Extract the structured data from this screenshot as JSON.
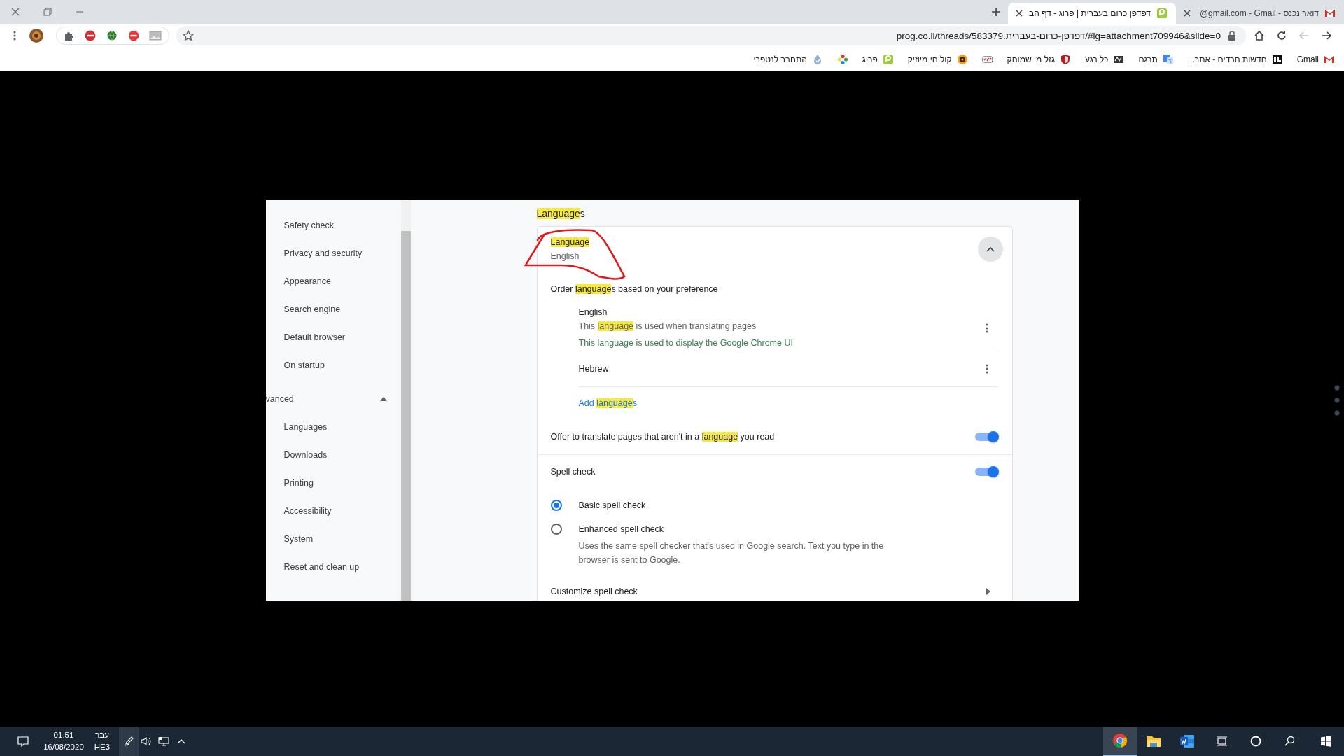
{
  "tabs": [
    {
      "title": "דפדפן כרום בעברית | פרוג - דף הב",
      "kind": "prog",
      "selected": true
    },
    {
      "title": "דואר נכנס - ‎@gmail.com - Gmail",
      "kind": "gmail",
      "selected": false
    }
  ],
  "toolbar": {
    "url": "prog.co.il/threads/583379.דפדפן-כרום-בעברית/#lg=attachment709946&slide=0",
    "nav_buttons": [
      {
        "kind": "back",
        "disabled": false
      },
      {
        "kind": "forward",
        "disabled": true
      }
    ]
  },
  "bookmarks": [
    {
      "kind": "gmail",
      "label": "Gmail"
    },
    {
      "kind": "news",
      "label": "חדשות חרדים - אתר..."
    },
    {
      "kind": "translate",
      "label": "תרגם"
    },
    {
      "kind": "moment",
      "label": "כל רגע"
    },
    {
      "kind": "shield",
      "label": "גזל מי שמוחק"
    },
    {
      "kind": "chi"
    },
    {
      "kind": "music",
      "label": "קול חי מיוזיק"
    },
    {
      "kind": "prog",
      "label": "פרוג"
    },
    {
      "kind": "flower"
    },
    {
      "kind": "netfree",
      "label": "התחבר לנטפרי"
    }
  ],
  "settings": {
    "sidebar": [
      {
        "kind": "item",
        "label": "Safety check"
      },
      {
        "kind": "item",
        "label": "Privacy and security"
      },
      {
        "kind": "item",
        "label": "Appearance"
      },
      {
        "kind": "item",
        "label": "Search engine"
      },
      {
        "kind": "item",
        "label": "Default browser"
      },
      {
        "kind": "item",
        "label": "On startup"
      },
      {
        "kind": "section",
        "label": "vanced",
        "expanded": true
      },
      {
        "kind": "item",
        "label": "Languages"
      },
      {
        "kind": "item",
        "label": "Downloads"
      },
      {
        "kind": "item",
        "label": "Printing"
      },
      {
        "kind": "item",
        "label": "Accessibility"
      },
      {
        "kind": "item",
        "label": "System"
      },
      {
        "kind": "item",
        "label": "Reset and clean up"
      }
    ],
    "heading": [
      {
        "text": "Language",
        "highlight": true
      },
      {
        "text": "s",
        "highlight": false
      }
    ],
    "card": {
      "title": [
        {
          "text": "Language",
          "highlight": true
        }
      ],
      "subtitle": "English",
      "expanded": true,
      "order_label": [
        {
          "text": "Order ",
          "highlight": false
        },
        {
          "text": "language",
          "highlight": true
        },
        {
          "text": "s based on your preference",
          "highlight": false
        }
      ],
      "languages": [
        {
          "name": "English",
          "notes": [
            {
              "kind": "plain",
              "parts": [
                {
                  "text": "This ",
                  "highlight": false
                },
                {
                  "text": "language",
                  "highlight": true
                },
                {
                  "text": " is used when translating pages",
                  "highlight": false
                }
              ]
            },
            {
              "kind": "ui",
              "parts": [
                {
                  "text": "This language is used to display the Google Chrome UI",
                  "highlight": false
                }
              ]
            }
          ]
        },
        {
          "name": "Hebrew"
        }
      ],
      "add_link": [
        {
          "text": "Add ",
          "highlight": false
        },
        {
          "text": "language",
          "highlight": true
        },
        {
          "text": "s",
          "highlight": false
        }
      ],
      "offer_translate": {
        "label": [
          {
            "text": "Offer to translate pages that aren't in a ",
            "highlight": false
          },
          {
            "text": "language",
            "highlight": true
          },
          {
            "text": " you read",
            "highlight": false
          }
        ],
        "on": true
      },
      "spell_check": {
        "label": "Spell check",
        "on": true,
        "options": [
          {
            "label": "Basic spell check",
            "selected": true
          },
          {
            "label": "Enhanced spell check",
            "description": "Uses the same spell checker that's used in Google search. Text you type in the browser is sent to Google.",
            "selected": false
          }
        ]
      },
      "customize": "Customize spell check"
    }
  },
  "taskbar": {
    "clock": {
      "time": "01:51",
      "date": "16/08/2020"
    },
    "input_language": {
      "script": "עבר",
      "code": "HE3"
    },
    "apps": [
      {
        "kind": "chrome",
        "selected": true
      },
      {
        "kind": "explorer",
        "selected": false
      },
      {
        "kind": "word",
        "selected": false
      }
    ]
  }
}
